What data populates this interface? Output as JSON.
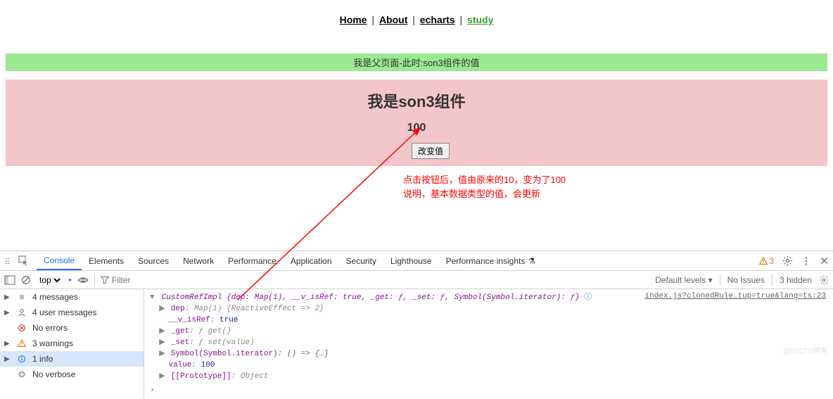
{
  "nav": {
    "items": [
      {
        "label": "Home",
        "active": false
      },
      {
        "label": "About",
        "active": false
      },
      {
        "label": "echarts",
        "active": false
      },
      {
        "label": "study",
        "active": true
      }
    ],
    "separator": " | "
  },
  "parent_bar": "我是父页面-此时:son3组件的值",
  "son3": {
    "title": "我是son3组件",
    "value": "100",
    "button_label": "改变值"
  },
  "annotation": {
    "line1": "点击按钮后，值由原来的10，变为了100",
    "line2": "说明，基本数据类型的值，会更新"
  },
  "devtools": {
    "tabs": [
      "Console",
      "Elements",
      "Sources",
      "Network",
      "Performance",
      "Application",
      "Security",
      "Lighthouse",
      "Performance insights"
    ],
    "active_tab": "Console",
    "warning_badge": "3",
    "toolbar": {
      "context": "top",
      "filter_placeholder": "Filter",
      "levels_label": "Default levels",
      "issues_label": "No Issues",
      "hidden_label": "3 hidden"
    },
    "sidebar": [
      {
        "icon": "messages",
        "label": "4 messages"
      },
      {
        "icon": "user",
        "label": "4 user messages"
      },
      {
        "icon": "error",
        "label": "No errors"
      },
      {
        "icon": "warning",
        "label": "3 warnings"
      },
      {
        "icon": "info",
        "label": "1 info",
        "selected": true
      },
      {
        "icon": "verbose",
        "label": "No verbose"
      }
    ],
    "console": {
      "source_link": "index.js?clonedRule…tup=true&lang=ts:23",
      "header": "CustomRefImpl {dep: Map(1), __v_isRef: true, _get: ƒ, _set: ƒ, Symbol(Symbol.iterator): ƒ}",
      "lines": [
        {
          "caret": "▶",
          "prop": "dep",
          "val": ": Map(1) {ReactiveEffect => 2}"
        },
        {
          "caret": "",
          "prop": "__v_isRef",
          "val": ": ",
          "bool": "true"
        },
        {
          "caret": "▶",
          "prop": "_get",
          "val": ": ƒ get()"
        },
        {
          "caret": "▶",
          "prop": "_set",
          "val": ": ƒ set(value)"
        },
        {
          "caret": "▶",
          "prop": "Symbol(Symbol.iterator)",
          "val": ": () => {…}"
        },
        {
          "caret": "",
          "prop": "value",
          "val": ": ",
          "num": "100"
        },
        {
          "caret": "▶",
          "prop": "[[Prototype]]",
          "val": ": Object"
        }
      ]
    }
  },
  "watermark": "@51CTO博客"
}
